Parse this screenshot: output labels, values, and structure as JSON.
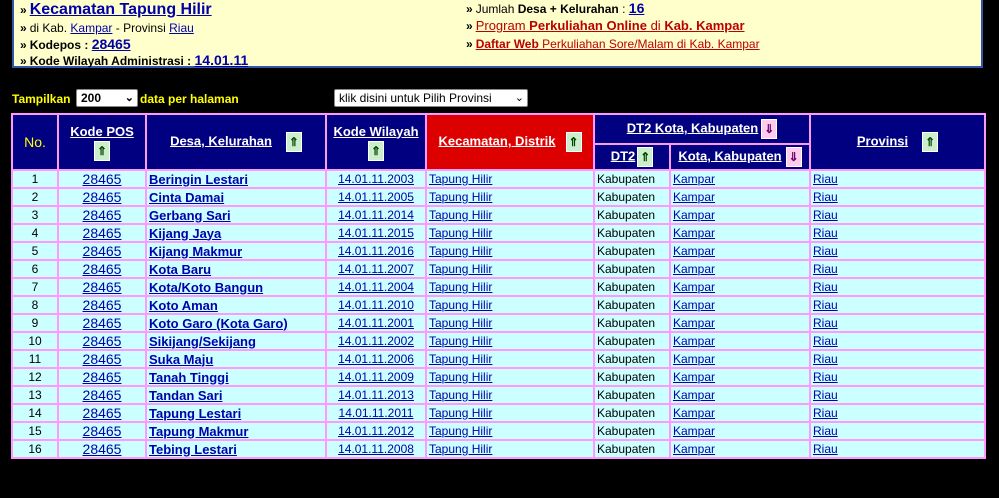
{
  "info": {
    "title": "Kecamatan Tapung Hilir",
    "di_kab_prefix": "di Kab.",
    "kab_name": "Kampar",
    "provinsi_sep": "- Provinsi",
    "prov_name": "Riau",
    "kodepos_label": "Kodepos :",
    "kodepos_value": "28465",
    "kode_wilayah_label": "Kode Wilayah Administrasi :",
    "kode_wilayah_value": "14.01.11",
    "jumlah_prefix": "Jumlah",
    "jumlah_label": "Desa + Kelurahan",
    "jumlah_colon": ":",
    "jumlah_value": "16",
    "promo1_a": "Program",
    "promo1_b": "Perkuliahan Online",
    "promo1_c": "di",
    "promo1_d": "Kab. Kampar",
    "promo2_a": "Daftar Web",
    "promo2_b": "Perkuliahan Sore/Malam di Kab. Kampar",
    "bullet": "»"
  },
  "controls": {
    "show_label": "Tampilkan",
    "per_page": "200",
    "per_page_suffix": "data per halaman",
    "province_select": "klik disini untuk Pilih Provinsi"
  },
  "table": {
    "headers": {
      "no": "No.",
      "kode_pos": "Kode POS",
      "desa": "Desa, Kelurahan",
      "kode_wilayah": "Kode Wilayah",
      "kecamatan": "Kecamatan, Distrik",
      "dt2_group": "DT2 Kota, Kabupaten",
      "dt2": "DT2",
      "kota": "Kota, Kabupaten",
      "provinsi": "Provinsi"
    },
    "rows": [
      {
        "no": "1",
        "pos": "28465",
        "desa": "Beringin Lestari",
        "kode": "14.01.11.2003",
        "kec": "Tapung Hilir",
        "dt2": "Kabupaten",
        "kota": "Kampar",
        "prov": "Riau"
      },
      {
        "no": "2",
        "pos": "28465",
        "desa": "Cinta Damai",
        "kode": "14.01.11.2005",
        "kec": "Tapung Hilir",
        "dt2": "Kabupaten",
        "kota": "Kampar",
        "prov": "Riau"
      },
      {
        "no": "3",
        "pos": "28465",
        "desa": "Gerbang Sari",
        "kode": "14.01.11.2014",
        "kec": "Tapung Hilir",
        "dt2": "Kabupaten",
        "kota": "Kampar",
        "prov": "Riau"
      },
      {
        "no": "4",
        "pos": "28465",
        "desa": "Kijang Jaya",
        "kode": "14.01.11.2015",
        "kec": "Tapung Hilir",
        "dt2": "Kabupaten",
        "kota": "Kampar",
        "prov": "Riau"
      },
      {
        "no": "5",
        "pos": "28465",
        "desa": "Kijang Makmur",
        "kode": "14.01.11.2016",
        "kec": "Tapung Hilir",
        "dt2": "Kabupaten",
        "kota": "Kampar",
        "prov": "Riau"
      },
      {
        "no": "6",
        "pos": "28465",
        "desa": "Kota Baru",
        "kode": "14.01.11.2007",
        "kec": "Tapung Hilir",
        "dt2": "Kabupaten",
        "kota": "Kampar",
        "prov": "Riau"
      },
      {
        "no": "7",
        "pos": "28465",
        "desa": "Kota/Koto Bangun",
        "kode": "14.01.11.2004",
        "kec": "Tapung Hilir",
        "dt2": "Kabupaten",
        "kota": "Kampar",
        "prov": "Riau"
      },
      {
        "no": "8",
        "pos": "28465",
        "desa": "Koto Aman",
        "kode": "14.01.11.2010",
        "kec": "Tapung Hilir",
        "dt2": "Kabupaten",
        "kota": "Kampar",
        "prov": "Riau"
      },
      {
        "no": "9",
        "pos": "28465",
        "desa": "Koto Garo (Kota Garo)",
        "kode": "14.01.11.2001",
        "kec": "Tapung Hilir",
        "dt2": "Kabupaten",
        "kota": "Kampar",
        "prov": "Riau"
      },
      {
        "no": "10",
        "pos": "28465",
        "desa": "Sikijang/Sekijang",
        "kode": "14.01.11.2002",
        "kec": "Tapung Hilir",
        "dt2": "Kabupaten",
        "kota": "Kampar",
        "prov": "Riau"
      },
      {
        "no": "11",
        "pos": "28465",
        "desa": "Suka Maju",
        "kode": "14.01.11.2006",
        "kec": "Tapung Hilir",
        "dt2": "Kabupaten",
        "kota": "Kampar",
        "prov": "Riau"
      },
      {
        "no": "12",
        "pos": "28465",
        "desa": "Tanah Tinggi",
        "kode": "14.01.11.2009",
        "kec": "Tapung Hilir",
        "dt2": "Kabupaten",
        "kota": "Kampar",
        "prov": "Riau"
      },
      {
        "no": "13",
        "pos": "28465",
        "desa": "Tandan Sari",
        "kode": "14.01.11.2013",
        "kec": "Tapung Hilir",
        "dt2": "Kabupaten",
        "kota": "Kampar",
        "prov": "Riau"
      },
      {
        "no": "14",
        "pos": "28465",
        "desa": "Tapung Lestari",
        "kode": "14.01.11.2011",
        "kec": "Tapung Hilir",
        "dt2": "Kabupaten",
        "kota": "Kampar",
        "prov": "Riau"
      },
      {
        "no": "15",
        "pos": "28465",
        "desa": "Tapung Makmur",
        "kode": "14.01.11.2012",
        "kec": "Tapung Hilir",
        "dt2": "Kabupaten",
        "kota": "Kampar",
        "prov": "Riau"
      },
      {
        "no": "16",
        "pos": "28465",
        "desa": "Tebing Lestari",
        "kode": "14.01.11.2008",
        "kec": "Tapung Hilir",
        "dt2": "Kabupaten",
        "kota": "Kampar",
        "prov": "Riau"
      }
    ]
  },
  "colors": {
    "page_bg": "#000000",
    "info_bg": "#ffffcc",
    "header_bg": "#000080",
    "header_active_bg": "#dd0000",
    "cell_bg": "#ccffff",
    "grid": "#ff99ff",
    "link": "#0000aa",
    "control_text": "#ffff00"
  },
  "icons": {
    "sort_up": "double-arrow-up-icon",
    "sort_down": "double-arrow-down-icon",
    "dropdown": "chevron-down-icon"
  }
}
